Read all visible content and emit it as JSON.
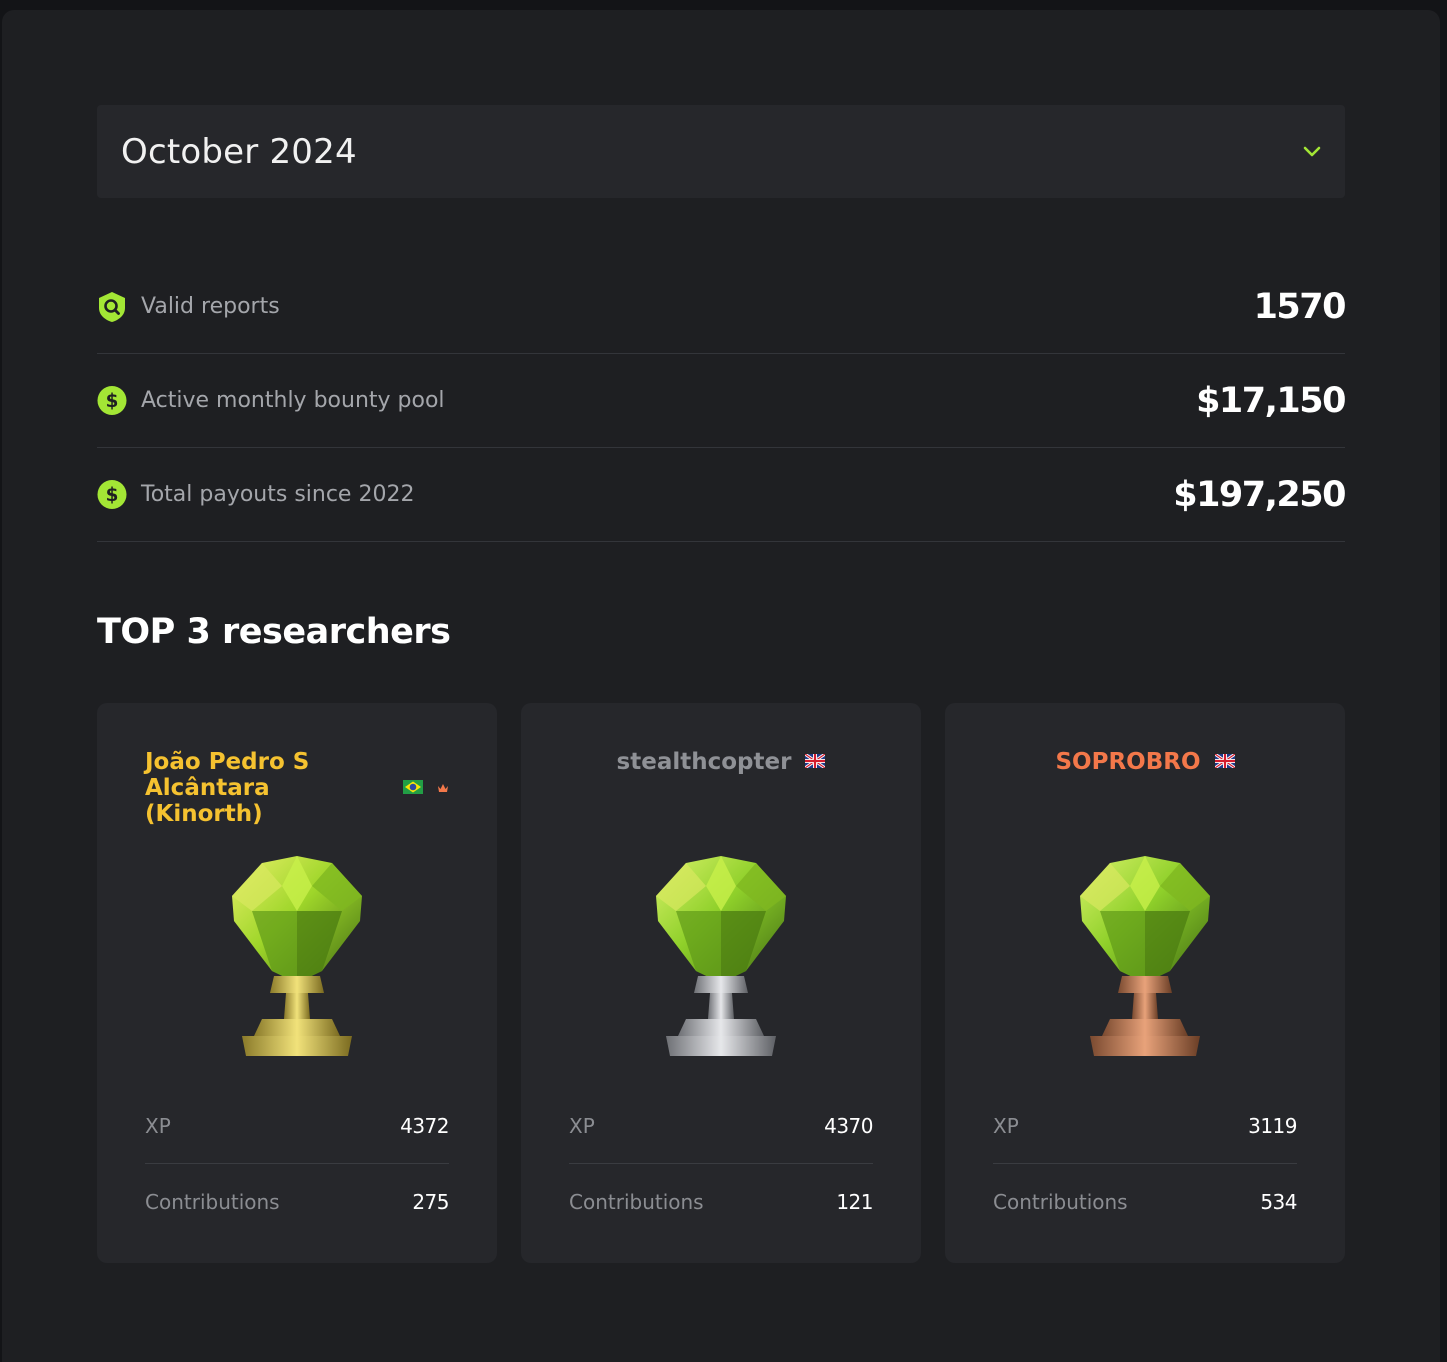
{
  "month_select": {
    "value": "October 2024",
    "icon": "chevron-down-icon"
  },
  "stats": [
    {
      "label": "Valid reports",
      "value": "1570",
      "icon": "shield-search-icon"
    },
    {
      "label": "Active monthly bounty pool",
      "value": "$17,150",
      "icon": "dollar-icon"
    },
    {
      "label": "Total payouts since 2022",
      "value": "$197,250",
      "icon": "dollar-icon"
    }
  ],
  "section_title": "TOP 3 researchers",
  "researchers": [
    {
      "name": "João Pedro S Alcântara (Kinorth)",
      "flag": "brazil-flag-icon",
      "badge": "crown-icon",
      "trophy": "gold-trophy",
      "xp_label": "XP",
      "xp": "4372",
      "contributions_label": "Contributions",
      "contributions": "275"
    },
    {
      "name": "stealthcopter",
      "flag": "uk-flag-icon",
      "trophy": "silver-trophy",
      "xp_label": "XP",
      "xp": "4370",
      "contributions_label": "Contributions",
      "contributions": "121"
    },
    {
      "name": "SOPROBRO",
      "flag": "uk-flag-icon",
      "trophy": "bronze-trophy",
      "xp_label": "XP",
      "xp": "3119",
      "contributions_label": "Contributions",
      "contributions": "534"
    }
  ],
  "colors": {
    "accent": "#a3e635",
    "gold": "#f5c230",
    "silver": "#c4c6cb",
    "bronze": "#f3784a"
  }
}
